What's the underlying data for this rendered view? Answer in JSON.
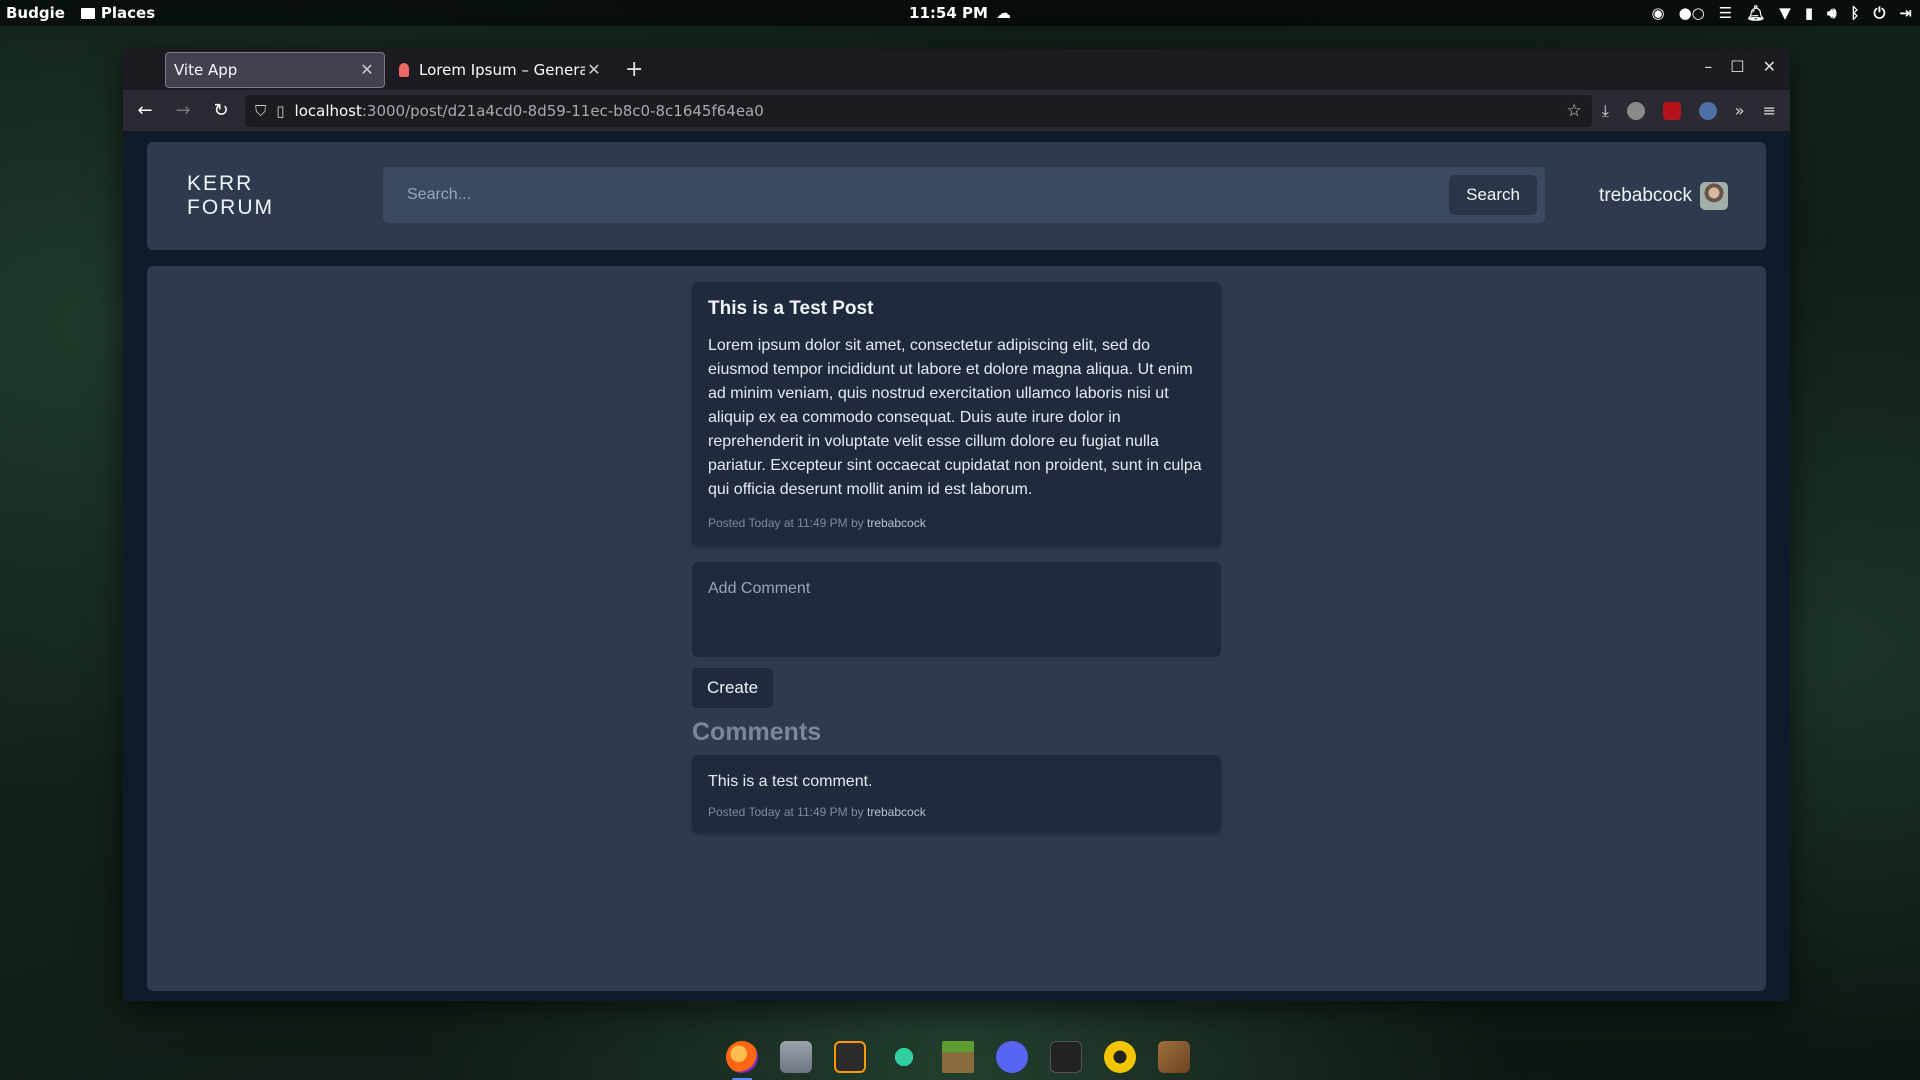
{
  "system_panel": {
    "menu_label": "Budgie",
    "places_label": "Places",
    "clock": "11:54 PM"
  },
  "browser": {
    "tabs": [
      {
        "title": "Vite App",
        "active": true
      },
      {
        "title": "Lorem Ipsum – Generat",
        "active": false
      }
    ],
    "url_host": "localhost",
    "url_path": ":3000/post/d21a4cd0-8d59-11ec-b8c0-8c1645f64ea0"
  },
  "site": {
    "brand": "KERR FORUM",
    "search": {
      "placeholder": "Search...",
      "button_label": "Search"
    },
    "username": "trebabcock"
  },
  "post": {
    "title": "This is a Test Post",
    "body": "Lorem ipsum dolor sit amet, consectetur adipiscing elit, sed do eiusmod tempor incididunt ut labore et dolore magna aliqua. Ut enim ad minim veniam, quis nostrud exercitation ullamco laboris nisi ut aliquip ex ea commodo consequat. Duis aute irure dolor in reprehenderit in voluptate velit esse cillum dolore eu fugiat nulla pariatur. Excepteur sint occaecat cupidatat non proident, sunt in culpa qui officia deserunt mollit anim id est laborum.",
    "meta_prefix": "Posted Today at 11:49 PM by",
    "author": "trebabcock"
  },
  "comment_form": {
    "placeholder": "Add Comment",
    "button_label": "Create"
  },
  "comments": {
    "heading": "Comments",
    "items": [
      {
        "text": "This is a test comment.",
        "meta_prefix": "Posted Today at 11:49 PM by",
        "author": "trebabcock"
      }
    ]
  },
  "dock": {
    "icons": [
      "firefox-icon",
      "files-icon",
      "sublime-icon",
      "tool-icon",
      "minecraft-icon",
      "discord-icon",
      "terminal-icon",
      "budgie-icon",
      "box-icon"
    ]
  }
}
